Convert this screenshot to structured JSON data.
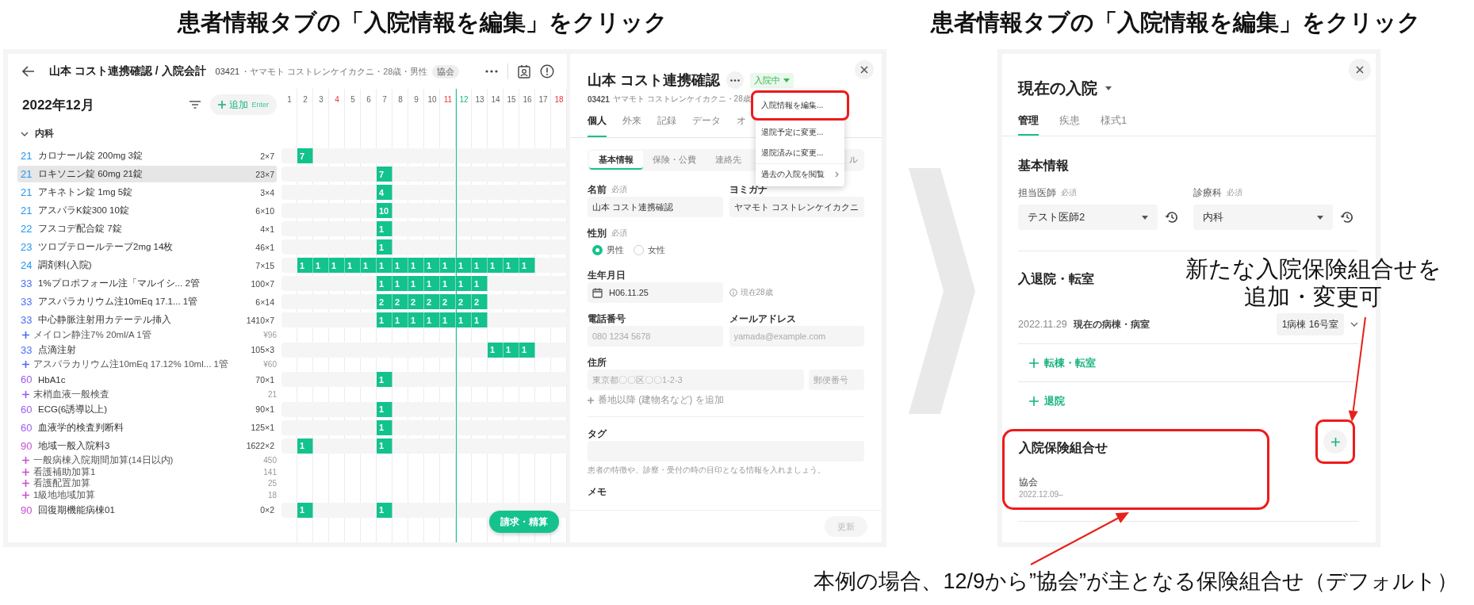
{
  "headings": [
    "患者情報タブの「入院情報を編集」をクリック",
    "患者情報タブの「入院情報を編集」をクリック"
  ],
  "billing_screen": {
    "title": "山本 コスト連携確認 / 入院会計",
    "patient_id": "03421",
    "patient_meta": "・ヤマモト コストレンケイカクニ・28歳・男性",
    "insurance_badge": "協会",
    "month": "2022年12月",
    "add_button": {
      "label": "追加",
      "shortcut": "Enter"
    },
    "section": {
      "label": "内科",
      "expanded": true
    },
    "days": [
      {
        "label": "1",
        "kind": "weekday"
      },
      {
        "label": "2",
        "kind": "weekday"
      },
      {
        "label": "3",
        "kind": "weekday"
      },
      {
        "label": "4",
        "kind": "sunday"
      },
      {
        "label": "5",
        "kind": "weekday"
      },
      {
        "label": "6",
        "kind": "weekday"
      },
      {
        "label": "7",
        "kind": "weekday"
      },
      {
        "label": "8",
        "kind": "weekday"
      },
      {
        "label": "9",
        "kind": "weekday"
      },
      {
        "label": "10",
        "kind": "weekday"
      },
      {
        "label": "11",
        "kind": "sunday"
      },
      {
        "label": "12",
        "kind": "today"
      },
      {
        "label": "13",
        "kind": "weekday"
      },
      {
        "label": "14",
        "kind": "weekday"
      },
      {
        "label": "15",
        "kind": "weekday"
      },
      {
        "label": "16",
        "kind": "weekday"
      },
      {
        "label": "17",
        "kind": "weekday"
      },
      {
        "label": "18",
        "kind": "sunday"
      }
    ],
    "items": [
      {
        "code": "21",
        "color": "#2196f3",
        "name": "カロナール錠 200mg 3錠",
        "quantity": "2×7",
        "selected": false,
        "cells": [
          null,
          "7"
        ]
      },
      {
        "code": "21",
        "color": "#2196f3",
        "name": "ロキソニン錠 60mg 21錠",
        "quantity": "23×7",
        "selected": true,
        "cells": [
          null,
          null,
          null,
          null,
          null,
          null,
          "7"
        ]
      },
      {
        "code": "21",
        "color": "#2196f3",
        "name": "アキネトン錠 1mg 5錠",
        "quantity": "3×4",
        "selected": false,
        "cells": [
          null,
          null,
          null,
          null,
          null,
          null,
          "4"
        ]
      },
      {
        "code": "21",
        "color": "#2196f3",
        "name": "アスパラK錠300 10錠",
        "quantity": "6×10",
        "selected": false,
        "cells": [
          null,
          null,
          null,
          null,
          null,
          null,
          "10"
        ]
      },
      {
        "code": "22",
        "color": "#2196f3",
        "name": "フスコデ配合錠 7錠",
        "quantity": "4×1",
        "selected": false,
        "cells": [
          null,
          null,
          null,
          null,
          null,
          null,
          "1"
        ]
      },
      {
        "code": "23",
        "color": "#2196f3",
        "name": "ツロブテロールテープ2mg 14枚",
        "quantity": "46×1",
        "selected": false,
        "cells": [
          null,
          null,
          null,
          null,
          null,
          null,
          "1"
        ]
      },
      {
        "code": "24",
        "color": "#2196f3",
        "name": "調剤料(入院)",
        "quantity": "7×15",
        "selected": false,
        "cells": [
          null,
          "1",
          "1",
          "1",
          "1",
          "1",
          "1",
          "1",
          "1",
          "1",
          "1",
          "1",
          "1",
          "1",
          "1",
          "1"
        ]
      },
      {
        "code": "33",
        "color": "#4a6cf7",
        "name": "1%プロポフォール注「マルイシ... 2管",
        "quantity": "100×7",
        "selected": false,
        "cells": [
          null,
          null,
          null,
          null,
          null,
          null,
          "1",
          "1",
          "1",
          "1",
          "1",
          "1",
          "1"
        ]
      },
      {
        "code": "33",
        "color": "#4a6cf7",
        "name": "アスパラカリウム注10mEq 17.1... 1管",
        "quantity": "6×14",
        "selected": false,
        "cells": [
          null,
          null,
          null,
          null,
          null,
          null,
          "2",
          "2",
          "2",
          "2",
          "2",
          "2",
          "2"
        ]
      },
      {
        "code": "33",
        "color": "#4a6cf7",
        "name": "中心静脈注射用カテーテル挿入",
        "quantity": "1410×7",
        "selected": false,
        "cells": [
          null,
          null,
          null,
          null,
          null,
          null,
          "1",
          "1",
          "1",
          "1",
          "1",
          "1",
          "1"
        ],
        "subs": [
          {
            "name": "メイロン静注7% 20ml/A 1管",
            "price": "¥96"
          }
        ]
      },
      {
        "code": "33",
        "color": "#4a6cf7",
        "name": "点滴注射",
        "quantity": "105×3",
        "selected": false,
        "cells": [
          null,
          null,
          null,
          null,
          null,
          null,
          null,
          null,
          null,
          null,
          null,
          null,
          null,
          "1",
          "1",
          "1"
        ],
        "subs": [
          {
            "name": "アスパラカリウム注10mEq 17.12% 10ml... 1管",
            "price": "¥60"
          }
        ]
      },
      {
        "code": "60",
        "color": "#9c5cf0",
        "name": "HbA1c",
        "quantity": "70×1",
        "selected": false,
        "cells": [
          null,
          null,
          null,
          null,
          null,
          null,
          "1"
        ],
        "subs": [
          {
            "name": "末梢血液一般検査",
            "price": "21"
          }
        ]
      },
      {
        "code": "60",
        "color": "#9c5cf0",
        "name": "ECG(6誘導以上)",
        "quantity": "90×1",
        "selected": false,
        "cells": [
          null,
          null,
          null,
          null,
          null,
          null,
          "1"
        ]
      },
      {
        "code": "60",
        "color": "#9c5cf0",
        "name": "血液学的検査判断料",
        "quantity": "125×1",
        "selected": false,
        "cells": [
          null,
          null,
          null,
          null,
          null,
          null,
          "1"
        ]
      },
      {
        "code": "90",
        "color": "#c94fcf",
        "name": "地域一般入院料3",
        "quantity": "1622×2",
        "selected": false,
        "cells": [
          null,
          "1",
          null,
          null,
          null,
          null,
          "1"
        ],
        "subs": [
          {
            "name": "一般病棟入院期間加算(14日以内)",
            "price": "450"
          },
          {
            "name": "看護補助加算1",
            "price": "141"
          },
          {
            "name": "看護配置加算",
            "price": "25"
          },
          {
            "name": "1級地地域加算",
            "price": "18"
          }
        ]
      },
      {
        "code": "90",
        "color": "#c94fcf",
        "name": "回復期機能病棟01",
        "quantity": "0×2",
        "selected": false,
        "cells": [
          null,
          "1",
          null,
          null,
          null,
          null,
          "1"
        ]
      }
    ],
    "checkout_button": "請求・精算"
  },
  "patient_panel": {
    "name": "山本 コスト連携確認",
    "status": "入院中",
    "patient_id": "03421",
    "meta": "ヤマモト コストレンケイカクニ・28歳",
    "tabs": [
      {
        "label": "個人",
        "selected": true
      },
      {
        "label": "外来",
        "selected": false
      },
      {
        "label": "記録",
        "selected": false
      },
      {
        "label": "データ",
        "selected": false
      },
      {
        "label": "オ",
        "selected": false
      }
    ],
    "subtabs": [
      {
        "label": "基本情報",
        "selected": true
      },
      {
        "label": "保険・公費",
        "selected": false
      },
      {
        "label": "連絡先",
        "selected": false
      },
      {
        "label": "ル",
        "selected": false
      }
    ],
    "menu": [
      {
        "label": "入院情報を編集...",
        "highlighted": true,
        "submenu": false
      },
      {
        "label": "退院予定に変更...",
        "highlighted": false,
        "submenu": false
      },
      {
        "label": "退院済みに変更...",
        "highlighted": false,
        "submenu": false
      },
      {
        "label": "過去の入院を閲覧",
        "highlighted": false,
        "submenu": true
      }
    ],
    "name_field": {
      "label": "名前",
      "required": "必須",
      "value": "山本 コスト連携確認"
    },
    "kana_field": {
      "label": "ヨミガナ",
      "value": "ヤマモト コストレンケイカクニ"
    },
    "gender": {
      "label": "性別",
      "required": "必須",
      "options": [
        {
          "label": "男性",
          "selected": true
        },
        {
          "label": "女性",
          "selected": false
        }
      ]
    },
    "birth": {
      "label": "生年月日",
      "value": "H06.11.25",
      "age_note": "現在28歳"
    },
    "phone": {
      "label": "電話番号",
      "placeholder": "080 1234 5678"
    },
    "email": {
      "label": "メールアドレス",
      "placeholder": "yamada@example.com"
    },
    "address": {
      "label": "住所",
      "placeholder": "東京都〇〇区〇〇1-2-3",
      "postal_placeholder": "郵便番号",
      "add_link": "番地以降 (建物名など) を追加"
    },
    "tags": {
      "label": "タグ",
      "hint": "患者の特徴や、診察・受付の時の目印となる情報を入れましょう。"
    },
    "memo_label": "メモ",
    "update_button": {
      "label": "更新",
      "disabled": true
    }
  },
  "admission_panel": {
    "title": "現在の入院",
    "tabs": [
      {
        "label": "管理",
        "selected": true
      },
      {
        "label": "疾患",
        "selected": false
      },
      {
        "label": "様式1",
        "selected": false
      }
    ],
    "basic_heading": "基本情報",
    "doctor": {
      "label": "担当医師",
      "required": "必須",
      "value": "テスト医師2"
    },
    "department": {
      "label": "診療科",
      "required": "必須",
      "value": "内科"
    },
    "transfer_heading": "入退院・転室",
    "current_ward": {
      "date": "2022.11.29",
      "label": "現在の病棟・病室",
      "room": "1病棟 16号室"
    },
    "actions": [
      "転棟・転室",
      "退院"
    ],
    "insurance": {
      "heading": "入院保険組合せ",
      "highlighted": true,
      "add_highlighted": true,
      "items": [
        {
          "name": "協会",
          "period": "2022.12.09–"
        }
      ]
    }
  },
  "annotations": {
    "note": "新たな入院保険組合せを追加・変更可",
    "caption": "本例の場合、12/9から”協会”が主となる保険組合せ（デフォルト）"
  }
}
